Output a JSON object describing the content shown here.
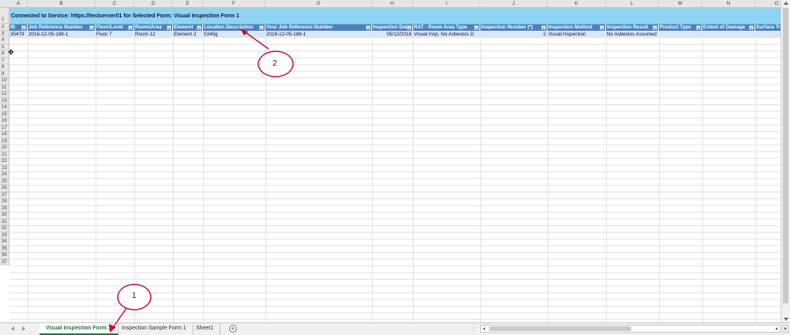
{
  "columns": [
    "A",
    "B",
    "C",
    "D",
    "E",
    "F",
    "G",
    "H",
    "I",
    "J",
    "K",
    "L",
    "M",
    "N",
    "O"
  ],
  "rows": [
    "1",
    "2",
    "3",
    "4",
    "5",
    "6",
    "7",
    "8",
    "9",
    "10",
    "11",
    "12",
    "13",
    "14",
    "15",
    "16",
    "17",
    "18",
    "19",
    "20",
    "21",
    "22",
    "23",
    "24",
    "25",
    "26",
    "27",
    "28",
    "29",
    "30",
    "31",
    "32",
    "33",
    "34",
    "35",
    "36",
    "37"
  ],
  "banner": "Connected to Service: https://testserver01 for Selected Form: Visual Inspection Form 1",
  "headers": [
    "ID",
    "Job Reference Number",
    "Floor/Level",
    "Room/Area",
    "Element",
    "Location Description",
    "Your Job Reference Number",
    "Inspection Date",
    "RAT - Room Area Type",
    "Inspection Number (*)",
    "Inspection Method",
    "Inspection Result",
    "Product Type",
    "Extent of Damage",
    "Surface Treatm"
  ],
  "record": [
    "35479",
    "2016-12-05-188-1",
    "Floor 7",
    "Room 12",
    "Element 2",
    "5345g",
    "2016-12-05-188-1",
    "05/12/2016",
    "Visual Insp. No Asbestos D",
    "2",
    "Visual Inspection",
    "No Asbestos Assumed",
    "",
    "",
    ""
  ],
  "sheets": [
    "Visual Inspection Form 1",
    "Inspection Sample Form 1",
    "Sheet1"
  ],
  "active_sheet": "Visual Inspection Form 1",
  "scroll_dots": "⋮",
  "callouts": [
    "1",
    "2"
  ],
  "icons": {
    "add_sheet": "plus-circle-icon",
    "cursor": "cell-cursor-icon"
  },
  "colors": {
    "banner": "#8fd3f5",
    "header": "#4f81bd",
    "record_row": "#dce6f1",
    "active_tab": "#217346"
  }
}
